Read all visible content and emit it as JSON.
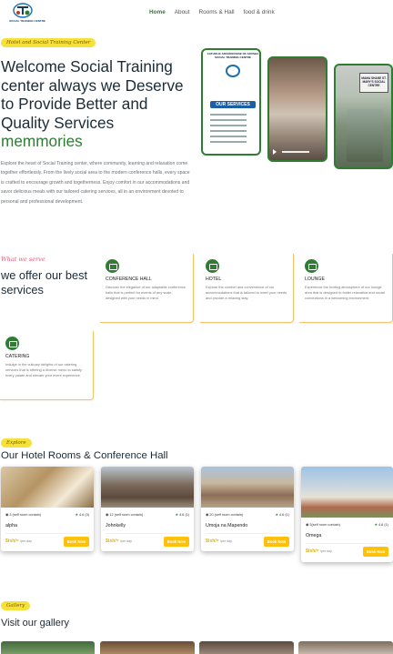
{
  "nav": {
    "logo_text": "SOCIAL TRAINING CENTRE",
    "items": [
      {
        "label": "Home",
        "active": true
      },
      {
        "label": "About"
      },
      {
        "label": "Rooms & Hall"
      },
      {
        "label": "food & drink"
      }
    ]
  },
  "hero": {
    "tagline": "Hotel and Social Training Center",
    "title": "Welcome Social Training center always we Deserve to Provide Better and Quality Services",
    "title_accent": "memmories",
    "description": "Explore the heart of Social Training center, where community, learning and relaxation come together effortlessly. From the lively social area to the modern conference halls, every space is crafted to encourage growth and togetherness. Enjoy comfort in our accommodations and savor delicious meals with our tailored catering services, all in an environment devoted to personal and professional development.",
    "poster_title": "CATHOLIC ARCHDIOCESE OF ARUSHA SOCIAL TRAINING CENTRE",
    "poster_heading": "OUR SERVICES",
    "sign_text": "MAMA SHANE ST. MARY'S SOCIAL CENTRE"
  },
  "services": {
    "script": "What we serve",
    "heading": "we offer our best services",
    "items": [
      {
        "title": "CONFERENCE HALL",
        "text": "Discover the elegance of our adaptable conference halls that is perfect for events of any scale, designed with your needs in mind."
      },
      {
        "title": "HOTEL",
        "text": "Explore the comfort and convenience of our accommodations that is tailored to meet your needs and provide a relaxing stay."
      },
      {
        "title": "LOUNGE",
        "text": "Experience the inviting atmosphere of our lounge area that is designed to foster relaxation and social connections in a welcoming environment."
      },
      {
        "title": "CATERING",
        "text": "Indulge in the culinary delights of our catering services that is offering a diverse menu to satisfy every palate and elevate your event experience."
      }
    ]
  },
  "rooms": {
    "script": "Explore",
    "heading": "Our Hotel Rooms & Conference Hall",
    "items": [
      {
        "capacity": "3 (self room contain)",
        "rating": "4.6 (3)",
        "name": "alpha",
        "price": "$tsh/=",
        "per": "/per day",
        "book": "Book Now"
      },
      {
        "capacity": "12 (self room contain)",
        "rating": "4.6 (1)",
        "name": "Johnkelly",
        "price": "$tsh/=",
        "per": "/per day",
        "book": "Book Now"
      },
      {
        "capacity": "20 (self room contain)",
        "rating": "4.6 (1)",
        "name": "Umoja na Mapendo",
        "price": "$tsh/=",
        "per": "/per day",
        "book": "Book Now"
      },
      {
        "capacity": "3(self room contain)",
        "rating": "4.6 (1)",
        "name": "Omega",
        "price": "$tsh/=",
        "per": "/per day",
        "book": "Book Now"
      }
    ]
  },
  "gallery": {
    "script": "Gallery",
    "heading": "Visit our gallery"
  }
}
